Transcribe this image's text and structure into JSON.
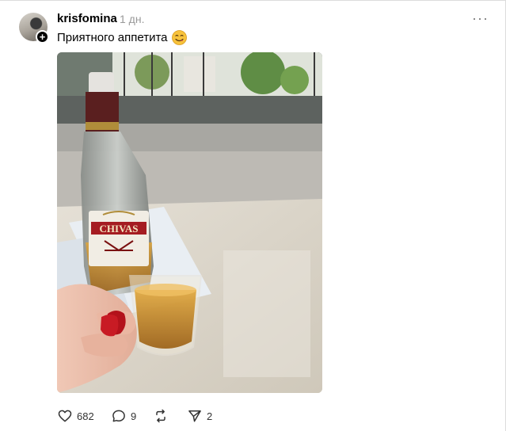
{
  "post": {
    "username": "krisfomina",
    "time": "1 дн.",
    "caption": "Приятного аппетита",
    "caption_emoji": "yum-emoji",
    "more_icon": "more-dots-icon"
  },
  "photo": {
    "label_text": "CHIVAS",
    "subject": "whisky-bottle-and-glass"
  },
  "actions": {
    "likes": "682",
    "comments": "9",
    "shares": "2",
    "icons": [
      "heart-icon",
      "comment-icon",
      "repost-icon",
      "share-icon"
    ]
  },
  "colors": {
    "text": "#000000",
    "muted": "#999999",
    "nail": "#b3121b",
    "whisky": "#c98a1e"
  }
}
